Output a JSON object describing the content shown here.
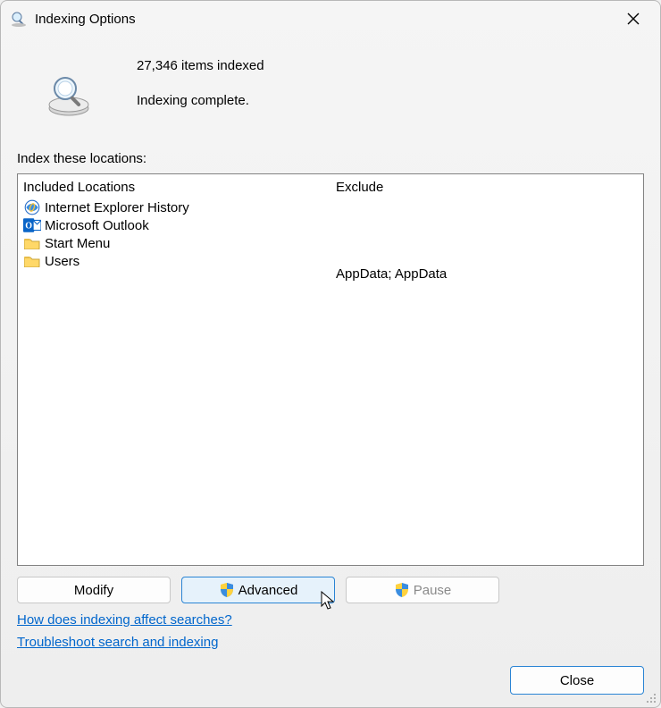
{
  "window": {
    "title": "Indexing Options"
  },
  "status": {
    "count_line": "27,346 items indexed",
    "state_line": "Indexing complete."
  },
  "locations_label": "Index these locations:",
  "headers": {
    "included": "Included Locations",
    "exclude": "Exclude"
  },
  "rows": [
    {
      "icon": "ie-icon",
      "label": "Internet Explorer History",
      "exclude": ""
    },
    {
      "icon": "outlook-icon",
      "label": "Microsoft Outlook",
      "exclude": ""
    },
    {
      "icon": "folder-icon",
      "label": "Start Menu",
      "exclude": ""
    },
    {
      "icon": "folder-icon",
      "label": "Users",
      "exclude": "AppData; AppData"
    }
  ],
  "buttons": {
    "modify": "Modify",
    "advanced": "Advanced",
    "pause": "Pause",
    "close": "Close"
  },
  "links": {
    "help": "How does indexing affect searches?",
    "troubleshoot": "Troubleshoot search and indexing"
  }
}
